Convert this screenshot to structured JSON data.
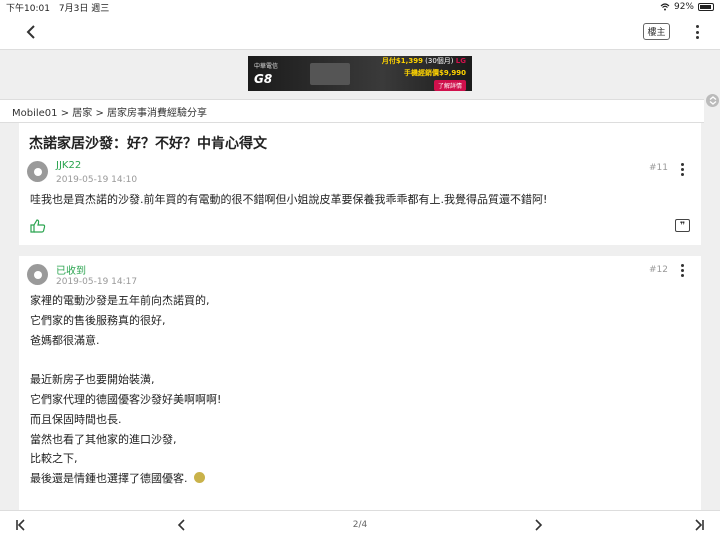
{
  "status_bar": {
    "time_date": "下午10:01　7月3日 週三",
    "battery": "92%"
  },
  "top_bar": {
    "host_label": "樓主"
  },
  "ad": {
    "brand": "中華電信",
    "model": "G8",
    "line1": "月付$1,399",
    "line1_note": "(30個月)",
    "line2": "手機經銷價$9,990",
    "logo": "LG",
    "cta": "了解詳情"
  },
  "breadcrumb": "Mobile01 > 居家 > 居家房事消費經驗分享",
  "thread_title": "杰諾家居沙發：好？不好？中肯心得文",
  "posts": [
    {
      "author": "JJK22",
      "time": "2019-05-19 14:10",
      "floor": "#11",
      "lines": [
        "哇我也是買杰諾的沙發.前年買的有電動的很不錯啊但小姐說皮革要保養我乖乖都有上.我覺得品質還不錯阿!"
      ]
    },
    {
      "author": "已收到",
      "time": "2019-05-19 14:17",
      "floor": "#12",
      "lines": [
        "家裡的電動沙發是五年前向杰諾買的,",
        "它們家的售後服務真的很好,",
        "爸媽都很滿意.",
        "",
        "最近新房子也要開始裝潢,",
        "它們家代理的德國優客沙發好美啊啊啊!",
        "而且保固時間也長.",
        "當然也看了其他家的進口沙發,",
        "比較之下,",
        "最後還是情鍾也選擇了德國優客."
      ]
    }
  ],
  "bottom_bar": {
    "page_indicator": "2/4"
  },
  "colors": {
    "author_green": "#2aa44f",
    "background": "#efefef"
  }
}
